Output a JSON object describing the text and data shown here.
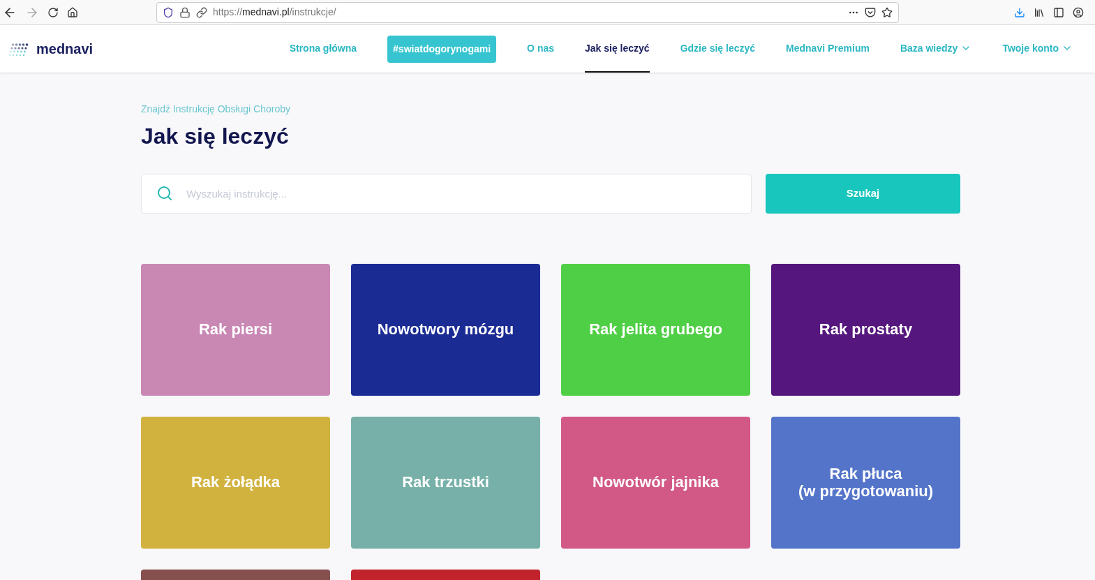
{
  "browser": {
    "url_scheme": "https://",
    "url_domain": "mednavi.pl",
    "url_path": "/instrukcje/"
  },
  "header": {
    "logo": "mednavi",
    "nav": [
      {
        "label": "Strona główna",
        "kind": "link",
        "selected": false,
        "dropdown": false
      },
      {
        "label": "#swiatdogorynogami",
        "kind": "highlight",
        "selected": false,
        "dropdown": false
      },
      {
        "label": "O nas",
        "kind": "link",
        "selected": false,
        "dropdown": false
      },
      {
        "label": "Jak się leczyć",
        "kind": "link",
        "selected": true,
        "dropdown": false
      },
      {
        "label": "Gdzie się leczyć",
        "kind": "link",
        "selected": false,
        "dropdown": false
      },
      {
        "label": "Mednavi Premium",
        "kind": "link",
        "selected": false,
        "dropdown": false
      },
      {
        "label": "Baza wiedzy",
        "kind": "link",
        "selected": false,
        "dropdown": true
      },
      {
        "label": "Twoje konto",
        "kind": "link",
        "selected": false,
        "dropdown": true
      }
    ]
  },
  "breadcrumb": "Znajdź Instrukcję Obsługi Choroby",
  "title": "Jak się leczyć",
  "search": {
    "placeholder": "Wyszukaj instrukcję...",
    "button": "Szukaj"
  },
  "cards": [
    {
      "title": "Rak piersi",
      "color": "#c987b4"
    },
    {
      "title": "Nowotwory mózgu",
      "color": "#1b2b94"
    },
    {
      "title": "Rak jelita grubego",
      "color": "#4fcf45"
    },
    {
      "title": "Rak prostaty",
      "color": "#55177d"
    },
    {
      "title": "Rak żołądka",
      "color": "#d1b23f"
    },
    {
      "title": "Rak trzustki",
      "color": "#77b0a8"
    },
    {
      "title": "Nowotwór jajnika",
      "color": "#d25886"
    },
    {
      "title": "Rak płuca\n(w przygotowaniu)",
      "color": "#5474c9"
    },
    {
      "color": "#86504f"
    },
    {
      "color": "#c0232c"
    }
  ]
}
